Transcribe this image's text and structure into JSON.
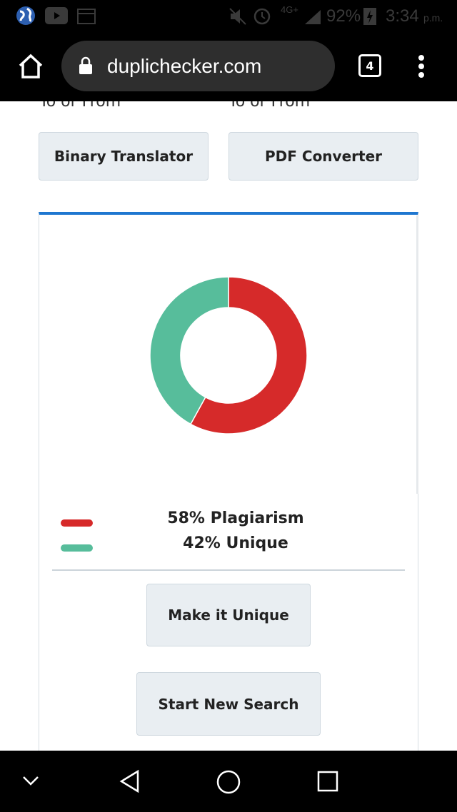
{
  "status_bar": {
    "battery": "92%",
    "time": "3:34",
    "ampm": "p.m.",
    "network": "4G+"
  },
  "browser": {
    "url": "duplichecker.com",
    "tab_count": "4"
  },
  "tools": {
    "clipped_left": "To or From",
    "clipped_right": "To or From",
    "binary_translator": "Binary Translator",
    "pdf_converter": "PDF Converter"
  },
  "chart_data": {
    "type": "pie",
    "donut": true,
    "series": [
      {
        "name": "58% Plagiarism",
        "value": 58,
        "color": "#d62a2a"
      },
      {
        "name": "42% Unique",
        "value": 42,
        "color": "#57bd9b"
      }
    ]
  },
  "result": {
    "plagiarism_label": "58% Plagiarism",
    "unique_label": "42% Unique",
    "make_unique": "Make it Unique",
    "new_search": "Start New Search"
  },
  "colors": {
    "accent": "#1f77d0",
    "plagiarism": "#d62a2a",
    "unique": "#57bd9b"
  }
}
